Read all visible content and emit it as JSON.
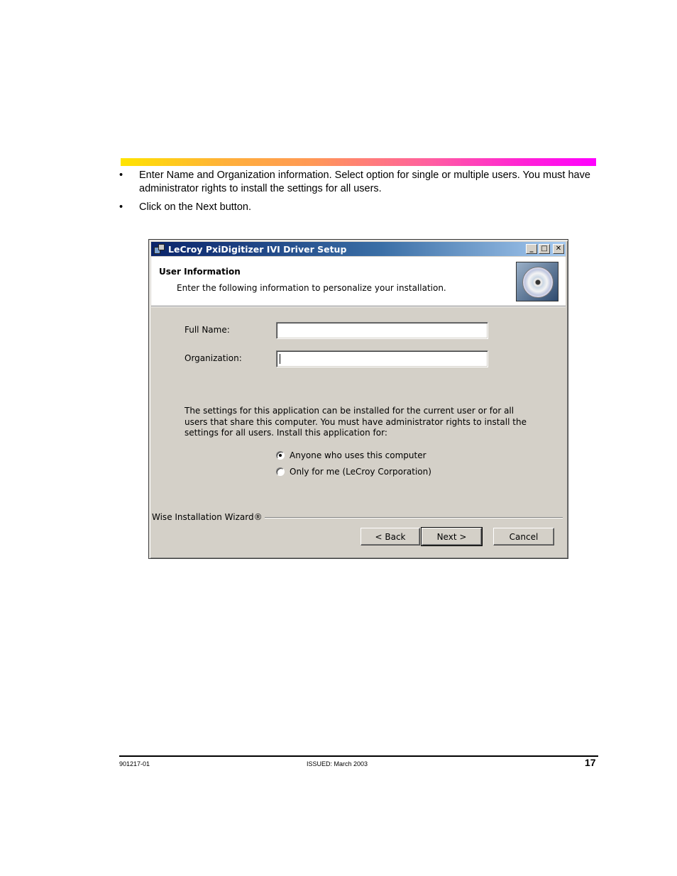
{
  "document": {
    "bullets": [
      "Enter Name and Organization information. Select option for single or multiple users. You must have administrator rights to install the settings for all users.",
      "Click on the Next button."
    ],
    "bullet_symbol": "•",
    "footer": {
      "doc_number": "901217-01",
      "issued": "ISSUED: March 2003",
      "page_number": "17"
    },
    "gradient_colors": [
      "#ffe400",
      "#ff9955",
      "#ff00ff"
    ]
  },
  "dialog": {
    "title": "LeCroy PxiDigitizer IVI Driver Setup",
    "window_buttons": {
      "minimize": "_",
      "maximize": "□",
      "close": "✕"
    },
    "header": {
      "title": "User Information",
      "subtitle": "Enter the following information to personalize your installation.",
      "icon": "cd-disc-icon"
    },
    "fields": {
      "full_name_label": "Full Name:",
      "full_name_value": "",
      "organization_label": "Organization:",
      "organization_value": ""
    },
    "info_text": "The settings for this application can be installed for the current user or for all users that share this computer. You must have administrator rights to install the settings for all users. Install this application for:",
    "radio_options": [
      {
        "label": "Anyone who uses this computer",
        "checked": true
      },
      {
        "label": "Only for me (LeCroy Corporation)",
        "checked": false
      }
    ],
    "brand": "Wise Installation Wizard®",
    "buttons": {
      "back": "< Back",
      "next": "Next >",
      "cancel": "Cancel"
    },
    "colors": {
      "face": "#d4d0c8",
      "titlebar_start": "#0a246a",
      "titlebar_end": "#a6caf0"
    }
  }
}
